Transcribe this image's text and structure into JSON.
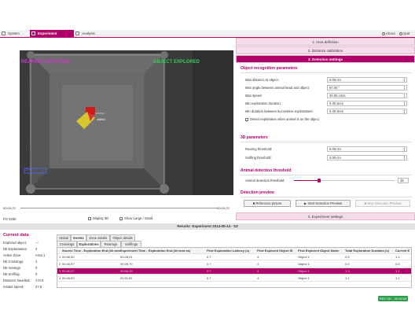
{
  "topbar": {
    "tabs": [
      {
        "label": "System",
        "icon": "gear-icon"
      },
      {
        "label": "Experiment",
        "icon": "flask-icon"
      },
      {
        "label": "Analysis",
        "icon": "chart-icon"
      }
    ],
    "about": "About",
    "quit": "Quit"
  },
  "video": {
    "left_label": "REARING DETECTED",
    "right_label": "OBJECT EXPLORED",
    "mini_label": "object1",
    "zone_label": "ZONE 1",
    "time_start": "00:00:23",
    "time_end": "00:00:23",
    "fps": "FG 2280",
    "display3d": "Display 3D",
    "showlarge": "Show Large / Small",
    "colors": {
      "left_label": "#cc33cc",
      "right_label": "#33cc55",
      "zone": "#4a6cff"
    }
  },
  "panel": {
    "sections": [
      "1. Area definition",
      "2. Distance calibration",
      "3. Detection settings",
      "4. Experiment settings"
    ],
    "object_group": "Object recognition parameters",
    "params": [
      {
        "label": "Max distance to object:",
        "value": "2.00 cm"
      },
      {
        "label": "Max angle between animal head and object:",
        "value": "67.00 °"
      },
      {
        "label": "Max speed:",
        "value": "30.00 cm/s"
      },
      {
        "label": "Min exploration duration:",
        "value": "0.30 secs"
      },
      {
        "label": "Min duration between successive explorations:",
        "value": "0.30 secs"
      }
    ],
    "detect_check": "Detect exploration when animal is on the object",
    "params3d_group": "3D parameters",
    "params3d": [
      {
        "label": "Rearing threshold:",
        "value": "6.00 cm"
      },
      {
        "label": "Sniffing threshold:",
        "value": "4.00 cm"
      }
    ],
    "animal_group": "Animal detection threshold",
    "animal_label": "Animal detection threshold:",
    "animal_value": "25",
    "animal_fraction": 0.25,
    "preview_group": "Detection preview",
    "btn_reference": "Reference picture",
    "btn_start": "Start Detection Preview",
    "btn_stop": "Stop Detection Preview"
  },
  "results": {
    "title": "Results: Experiment 2014-05-14 - S3",
    "current_title": "Current data",
    "current": [
      {
        "label": "Explored object:",
        "value": "---"
      },
      {
        "label": "Nb Explorations:",
        "value": "4"
      },
      {
        "label": "Active Zone:",
        "value": "Area 1"
      },
      {
        "label": "Nb Crossings:",
        "value": "1"
      },
      {
        "label": "Nb rearings:",
        "value": "0"
      },
      {
        "label": "Nb Sniffing:",
        "value": "0"
      },
      {
        "label": "Distance travelled:",
        "value": "174.6"
      },
      {
        "label": "Instant speed:",
        "value": "27.6"
      }
    ],
    "tabs1": [
      "Global",
      "Events",
      "Zone details",
      "Object details"
    ],
    "tabs2": [
      "Crossings",
      "Explorations",
      "Rearings",
      "Sniffings"
    ],
    "columns": [
      "",
      "Source Time - Exploration End (hh:mm:ss)",
      "Experiment Time - Exploration End (hh:mm:ss)",
      "First Exploration Latency (s)",
      "First Explored Object ID",
      "First Explored Object Name",
      "Total Exploration Duration (s)",
      "Current E"
    ],
    "rows": [
      [
        "1",
        "00:46,50",
        "00:26,01",
        "0.7",
        "4",
        "Object 1",
        "0.5",
        "1.1"
      ],
      [
        "2",
        "00:46,57",
        "00:26,70",
        "0.7",
        "4",
        "Object 1",
        "0.0",
        "0.6"
      ],
      [
        "3",
        "00:46,57",
        "00:56,53",
        "0.7",
        "4",
        "Object 1",
        "1.3",
        "1.1"
      ],
      [
        "4",
        "00:48,52",
        "00:51,81",
        "0.7",
        "4",
        "Object 1",
        "1.1",
        "1.1"
      ]
    ],
    "selected_row": 2
  },
  "status": "REC OK - 00:00:03"
}
